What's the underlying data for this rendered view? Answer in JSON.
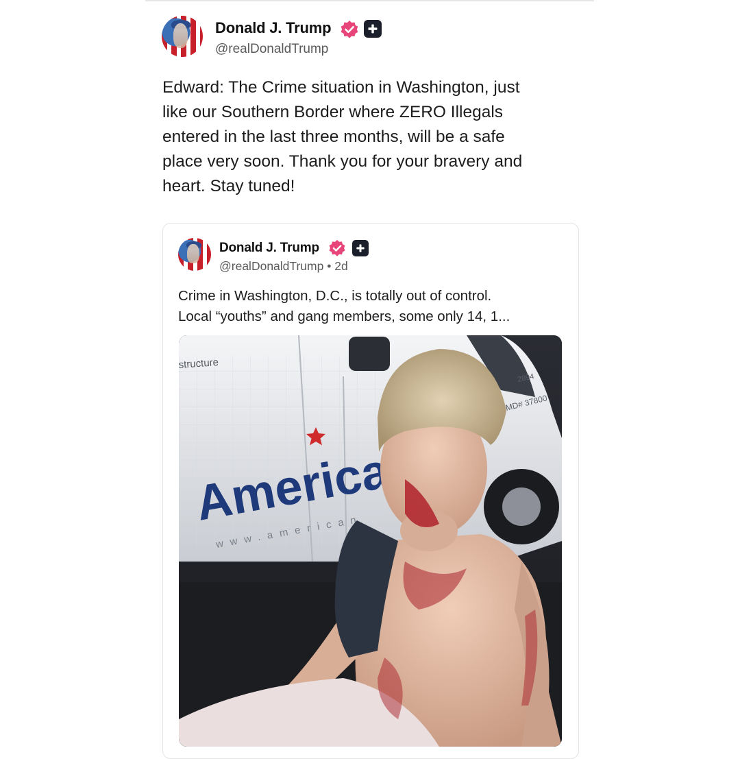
{
  "post": {
    "author_name": "Donald J. Trump",
    "handle": "@realDonaldTrump",
    "text": "Edward: The Crime situation in Washington, just\nlike our Southern Border where ZERO Illegals\nentered in the last three months, will be a safe\nplace very soon. Thank you for your bravery and\nheart. Stay tuned!"
  },
  "quoted_post": {
    "author_name": "Donald J. Trump",
    "handle": "@realDonaldTrump",
    "separator": "•",
    "time": "2d",
    "text": "Crime in Washington, D.C., is totally out of control.\nLocal “youths” and gang members, some only 14, 1..."
  },
  "photo": {
    "van_text_top": "structure",
    "van_brand": "American",
    "van_url": "www.american",
    "plate_text": "MD# 37800",
    "vehicle_number": "2894"
  },
  "colors": {
    "verified_badge": "#e8457a",
    "plus_badge": "#1a1f2b",
    "card_border": "#e3e3e3",
    "handle_text": "#5a5a5a"
  },
  "icons": {
    "verified": "verified-badge-icon",
    "plus": "plus-icon"
  }
}
